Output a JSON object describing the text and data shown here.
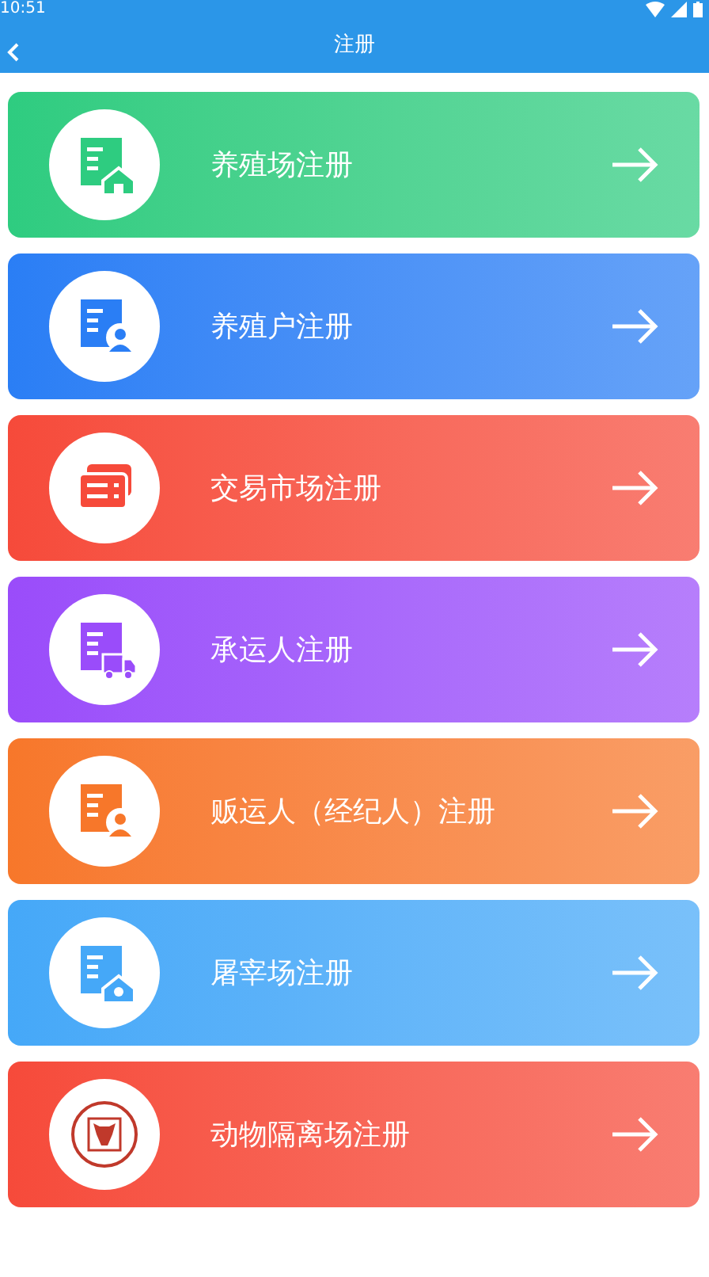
{
  "status_bar": {
    "time": "10:51"
  },
  "header": {
    "title": "注册"
  },
  "items": [
    {
      "label": "养殖场注册",
      "kind": "farm",
      "color": "#2ecc80"
    },
    {
      "label": "养殖户注册",
      "kind": "farmer",
      "color": "#2a7ef5"
    },
    {
      "label": "交易市场注册",
      "kind": "market",
      "color": "#f64a3a"
    },
    {
      "label": "承运人注册",
      "kind": "carrier",
      "color": "#9a4cfa"
    },
    {
      "label": "贩运人（经纪人）注册",
      "kind": "broker",
      "color": "#f7772a"
    },
    {
      "label": "屠宰场注册",
      "kind": "slaughter",
      "color": "#45a8f8"
    },
    {
      "label": "动物隔离场注册",
      "kind": "isolation",
      "color": "#f64a3a"
    }
  ]
}
